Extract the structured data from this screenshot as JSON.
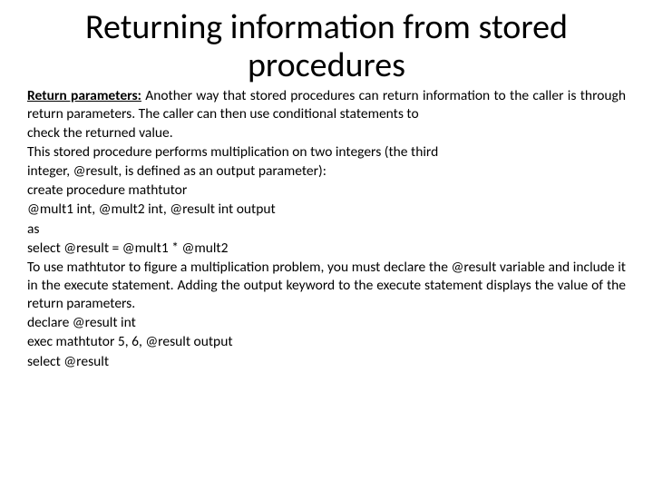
{
  "title": "Returning information from stored procedures",
  "lead_label": "Return parameters:",
  "p1a": " Another way that stored procedures can return information to the caller is through return parameters. The caller can then use conditional statements to",
  "p2": "check the returned value.",
  "p3": "This stored procedure performs multiplication on two integers (the third",
  "p4": "integer, @result, is defined as an output parameter):",
  "p5": "create procedure mathtutor",
  "p6": "@mult1 int, @mult2 int, @result int output",
  "p7": "as",
  "p8": "select @result = @mult1 * @mult2",
  "p9": "To use mathtutor to figure a multiplication problem, you must declare the @result variable and include it in the execute statement. Adding the output keyword to the execute statement displays the value of the return parameters.",
  "p10": "declare @result int",
  "p11": "exec mathtutor 5, 6, @result output",
  "p12": "select @result"
}
